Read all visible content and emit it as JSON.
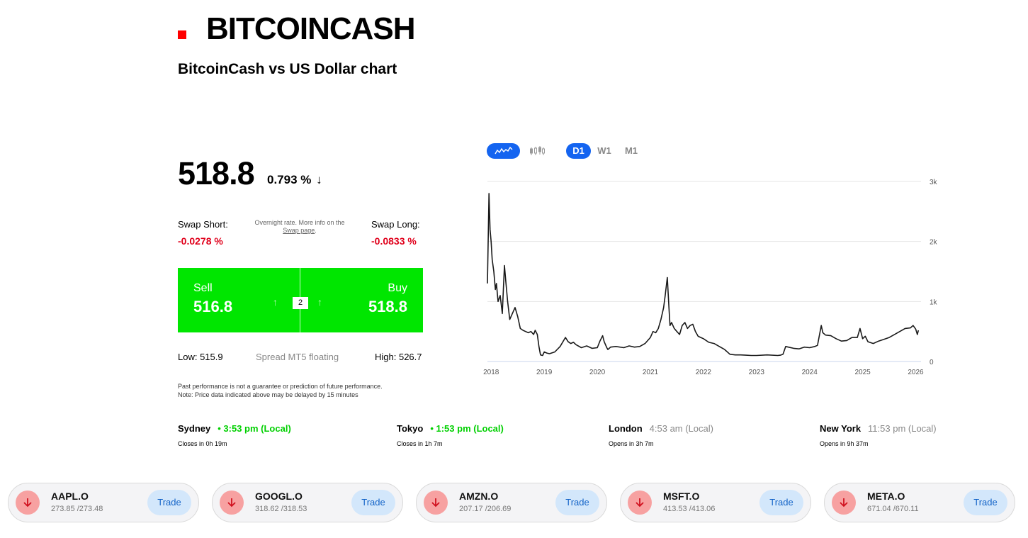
{
  "header": {
    "title": "BITCOINCASH",
    "subtitle": "BitcoinCash vs US Dollar chart",
    "brand_color": "#ff0000"
  },
  "quote": {
    "price": "518.8",
    "change": "0.793 %",
    "change_direction": "down"
  },
  "swap": {
    "short_label": "Swap Short:",
    "short_value": "-0.0278 %",
    "note_prefix": "Overnight rate. More info on the",
    "note_link": "Swap page",
    "note_suffix": ".",
    "long_label": "Swap Long:",
    "long_value": "-0.0833 %"
  },
  "trade": {
    "sell_label": "Sell",
    "sell_price": "516.8",
    "buy_label": "Buy",
    "buy_price": "518.8",
    "spread": "2",
    "accent_color": "#00e600"
  },
  "range": {
    "low": "Low: 515.9",
    "spread_text": "Spread MT5 floating",
    "high": "High: 526.7"
  },
  "disclaimer": {
    "line1": "Past performance is not a guarantee or prediction of future performance.",
    "line2": "Note: Price data indicated above may be delayed by 15 minutes"
  },
  "chart_controls": {
    "line_icon": "line-chart-icon",
    "candle_icon": "candlestick-icon",
    "timeframes": [
      "D1",
      "W1",
      "M1"
    ],
    "active_timeframe": "D1",
    "active_color": "#1464f0"
  },
  "chart_data": {
    "type": "line",
    "xlabel": "",
    "ylabel": "",
    "x_ticks": [
      "2018",
      "2019",
      "2020",
      "2021",
      "2022",
      "2023",
      "2024",
      "2025",
      "2026"
    ],
    "y_ticks": [
      "3k",
      "2k",
      "1k",
      "0"
    ],
    "ylim": [
      0,
      3000
    ],
    "xlim": [
      2017.93,
      2026.1
    ],
    "grid": true,
    "series": [
      {
        "x": [
          2017.93,
          2017.96,
          2017.98,
          2018.0,
          2018.02,
          2018.05,
          2018.08,
          2018.1,
          2018.13,
          2018.17,
          2018.21,
          2018.25,
          2018.28,
          2018.31,
          2018.35,
          2018.4,
          2018.45,
          2018.5,
          2018.55,
          2018.6,
          2018.65,
          2018.7,
          2018.75,
          2018.8,
          2018.83,
          2018.87,
          2018.9,
          2018.93,
          2018.97,
          2019.0,
          2019.05,
          2019.1,
          2019.2,
          2019.3,
          2019.4,
          2019.45,
          2019.5,
          2019.55,
          2019.6,
          2019.7,
          2019.8,
          2019.9,
          2020.0,
          2020.05,
          2020.1,
          2020.13,
          2020.18,
          2020.2,
          2020.25,
          2020.35,
          2020.5,
          2020.6,
          2020.7,
          2020.8,
          2020.9,
          2021.0,
          2021.05,
          2021.1,
          2021.15,
          2021.2,
          2021.25,
          2021.28,
          2021.32,
          2021.35,
          2021.37,
          2021.4,
          2021.45,
          2021.5,
          2021.55,
          2021.6,
          2021.65,
          2021.7,
          2021.75,
          2021.8,
          2021.85,
          2021.9,
          2021.95,
          2022.0,
          2022.1,
          2022.2,
          2022.3,
          2022.4,
          2022.5,
          2022.6,
          2022.7,
          2022.8,
          2022.9,
          2023.0,
          2023.2,
          2023.4,
          2023.45,
          2023.5,
          2023.55,
          2023.6,
          2023.7,
          2023.8,
          2023.9,
          2024.0,
          2024.1,
          2024.15,
          2024.22,
          2024.25,
          2024.3,
          2024.4,
          2024.5,
          2024.6,
          2024.7,
          2024.8,
          2024.9,
          2024.95,
          2025.0,
          2025.05,
          2025.1,
          2025.2,
          2025.3,
          2025.4,
          2025.5,
          2025.6,
          2025.7,
          2025.8,
          2025.9,
          2025.95,
          2026.0,
          2026.03,
          2026.05
        ],
        "y": [
          1300,
          2800,
          2200,
          2000,
          1700,
          1500,
          1200,
          1300,
          1000,
          1100,
          800,
          1600,
          1300,
          1000,
          700,
          800,
          900,
          750,
          550,
          520,
          500,
          480,
          500,
          450,
          520,
          450,
          250,
          110,
          100,
          160,
          140,
          130,
          160,
          250,
          400,
          330,
          300,
          320,
          280,
          230,
          260,
          220,
          230,
          340,
          430,
          330,
          230,
          200,
          240,
          250,
          230,
          260,
          240,
          250,
          300,
          400,
          500,
          480,
          550,
          700,
          900,
          1100,
          1400,
          900,
          600,
          650,
          550,
          500,
          450,
          600,
          650,
          550,
          600,
          620,
          500,
          420,
          400,
          380,
          320,
          300,
          250,
          200,
          120,
          110,
          110,
          105,
          100,
          100,
          110,
          100,
          105,
          120,
          250,
          240,
          220,
          210,
          240,
          230,
          250,
          270,
          600,
          480,
          440,
          430,
          380,
          340,
          350,
          400,
          400,
          550,
          380,
          420,
          330,
          300,
          340,
          370,
          400,
          450,
          500,
          550,
          560,
          600,
          540,
          450,
          520
        ],
        "color": "#1a1a1a"
      }
    ]
  },
  "markets": [
    {
      "city": "Sydney",
      "time": "• 3:53 pm (Local)",
      "status": "open",
      "note": "Closes in 0h 19m"
    },
    {
      "city": "Tokyo",
      "time": "• 1:53 pm (Local)",
      "status": "open",
      "note": "Closes in 1h 7m"
    },
    {
      "city": "London",
      "time": "4:53 am (Local)",
      "status": "closed",
      "note": "Opens in 3h 7m"
    },
    {
      "city": "New York",
      "time": "11:53 pm (Local)",
      "status": "closed",
      "note": "Opens in 9h 37m"
    }
  ],
  "tickers": [
    {
      "symbol": "AAPL.O",
      "prices": "273.85 /273.48",
      "trade": "Trade",
      "icon": "down-arrow-icon"
    },
    {
      "symbol": "GOOGL.O",
      "prices": "318.62 /318.53",
      "trade": "Trade",
      "icon": "down-arrow-icon"
    },
    {
      "symbol": "AMZN.O",
      "prices": "207.17 /206.69",
      "trade": "Trade",
      "icon": "down-arrow-icon"
    },
    {
      "symbol": "MSFT.O",
      "prices": "413.53 /413.06",
      "trade": "Trade",
      "icon": "down-arrow-icon"
    },
    {
      "symbol": "META.O",
      "prices": "671.04 /670.11",
      "trade": "Trade",
      "icon": "down-arrow-icon"
    }
  ]
}
